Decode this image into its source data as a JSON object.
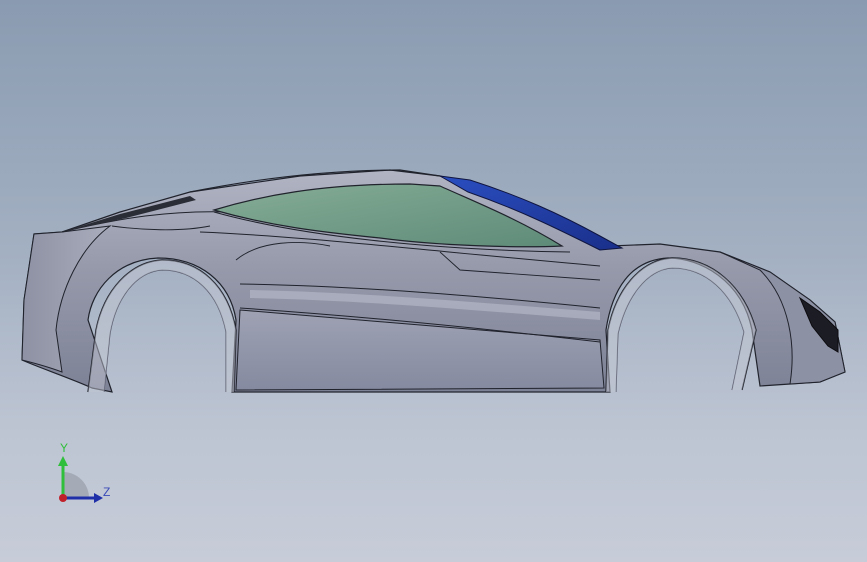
{
  "viewport": {
    "model": "car-body-side-view",
    "background_top": "#8a9bb1",
    "background_bottom": "#c7ccd8"
  },
  "triad": {
    "y_label": "Y",
    "z_label": "Z",
    "y_color": "#2fbf3a",
    "z_color": "#1f2fa8",
    "x_color": "#c0202a"
  },
  "colors": {
    "body": "#9497a8",
    "body_light": "#a7abbb",
    "body_dark": "#6f7387",
    "glass": "#6f9a86",
    "rear_glass": "#1e3ea0",
    "edge": "#20232c"
  }
}
